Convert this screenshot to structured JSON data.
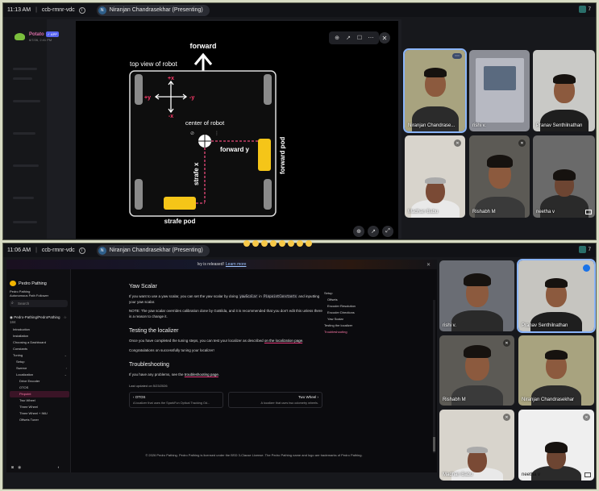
{
  "screen1": {
    "time": "11:13 AM",
    "meeting_code": "ccb-rmnr-vdc",
    "presenter": "Niranjan Chandrasekhar (Presenting)",
    "presenter_initial": "N",
    "participant_count": "7",
    "discord": {
      "user_name": "Potato",
      "app_tag": "✓ APP",
      "timestamp": "6/7/26, 2:41 PM"
    },
    "diagram": {
      "forward": "forward",
      "top_view": "top view of robot",
      "plus_x": "+x",
      "minus_x": "-x",
      "plus_y": "+y",
      "minus_y": "-y",
      "center": "center of robot",
      "forward_y": "forward y",
      "strafe_x": "strafe x",
      "forward_pod": "forward pod",
      "strafe_pod": "strafe pod"
    },
    "tiles": [
      {
        "name": "Niranjan Chandrase..."
      },
      {
        "name": "rishi v."
      },
      {
        "name": "Pranav Senthilnathan"
      },
      {
        "name": "Madhan Babu"
      },
      {
        "name": "Rishabh M"
      },
      {
        "name": "neetha v"
      }
    ]
  },
  "screen2": {
    "time": "11:06 AM",
    "meeting_code": "ccb-rmnr-vdc",
    "presenter": "Niranjan Chandrasekhar (Presenting)",
    "presenter_initial": "N",
    "participant_count": "7",
    "banner": {
      "text": "Ivy is released!",
      "link": "Learn more"
    },
    "brand": {
      "name": "Pedro Pathing",
      "sub1": "Pedro Pathing",
      "sub2": "Autonomous Path Follower"
    },
    "search_placeholder": "Search",
    "repo": {
      "name": "Pedro-Pathing/PedroPathing",
      "stars": "☆ 184"
    },
    "nav": [
      {
        "label": "Introduction",
        "level": 1,
        "caret": ""
      },
      {
        "label": "Installation",
        "level": 1,
        "caret": ""
      },
      {
        "label": "Choosing a Dashboard",
        "level": 1,
        "caret": ""
      },
      {
        "label": "Constants",
        "level": 1,
        "caret": ""
      },
      {
        "label": "Tuning",
        "level": 1,
        "caret": "⌄"
      },
      {
        "label": "Setup",
        "level": 2,
        "caret": ""
      },
      {
        "label": "Swerve",
        "level": 2,
        "caret": "›"
      },
      {
        "label": "Localization",
        "level": 2,
        "caret": "⌄"
      },
      {
        "label": "Drive Encoder",
        "level": 3,
        "caret": ""
      },
      {
        "label": "OTOS",
        "level": 3,
        "caret": ""
      },
      {
        "label": "Pinpoint",
        "level": 3,
        "caret": "",
        "active": true
      },
      {
        "label": "Two Wheel",
        "level": 3,
        "caret": ""
      },
      {
        "label": "Three Wheel",
        "level": 3,
        "caret": ""
      },
      {
        "label": "Three Wheel + IMU",
        "level": 3,
        "caret": ""
      },
      {
        "label": "Offsets Tuner",
        "level": 3,
        "caret": ""
      }
    ],
    "content": {
      "h_yaw": "Yaw Scalar",
      "p_yaw_1": "If you want to use a yaw scalar, you can set the yaw scalar by doing",
      "code1": "yawScalar",
      "p_yaw_in": "in",
      "code2": "PinpointConstants",
      "p_yaw_2": "and inputting your yaw scalar.",
      "p_note": "NOTE: The yaw scalar overrides calibration done by GoBilda, and it is recommended that you don't edit this unless there is a reason to change it.",
      "h_test": "Testing the localizer",
      "p_test_1": "Once you have completed the tuning steps, you can test your localizer as described",
      "p_test_link": "on the localization page",
      "p_test_end": ".",
      "p_congrats": "Congratulations on successfully tuning your localizer!",
      "h_trouble": "Troubleshooting",
      "p_trouble_1": "If you have any problems, see the",
      "p_trouble_link": "troubleshooting page",
      "p_trouble_end": ".",
      "updated": "Last updated on 5/23/2026",
      "prev_title": "‹  OTOS",
      "prev_desc": "A localizer that uses the SparkFun Optical Tracking Od...",
      "next_title": "Two Wheel  ›",
      "next_desc": "A localizer that uses two odometry wheels."
    },
    "toc": [
      {
        "label": "Setup",
        "sub": false
      },
      {
        "label": "Offsets",
        "sub": true
      },
      {
        "label": "Encoder Resolution",
        "sub": true
      },
      {
        "label": "Encoder Directions",
        "sub": true
      },
      {
        "label": "Yaw Scalar",
        "sub": true
      },
      {
        "label": "Testing the localizer",
        "sub": false
      },
      {
        "label": "Troubleshooting",
        "sub": false,
        "active": true
      }
    ],
    "footer": "© 2026 Pedro Pathing. Pedro Pathing is licensed under the BSD 3-Clause License. The Pedro Pathing name and logo are trademarks of Pedro Pathing.",
    "tiles": [
      {
        "name": "rishi v."
      },
      {
        "name": "Pranav Senthilnathan"
      },
      {
        "name": "Rishabh M"
      },
      {
        "name": "Niranjan Chandrasekhar"
      },
      {
        "name": "Madhan Babu"
      },
      {
        "name": "neetha v"
      }
    ]
  },
  "colors": {
    "pod_yellow": "#f5c518",
    "dashed_red": "#e84a7a",
    "accent_pink": "#ff79a8",
    "active_blue": "#8ab4f8"
  }
}
